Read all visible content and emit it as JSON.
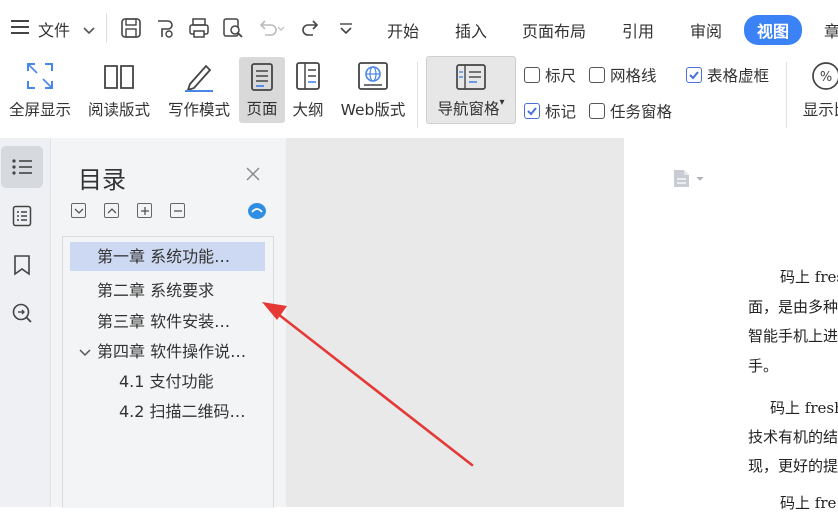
{
  "menubar": {
    "file_label": "文件",
    "tabs": [
      "开始",
      "插入",
      "页面布局",
      "引用",
      "审阅",
      "视图",
      "章"
    ],
    "active_tab": "视图"
  },
  "ribbon": {
    "buttons": {
      "fullscreen": "全屏显示",
      "reading": "阅读版式",
      "writing": "写作模式",
      "page": "页面",
      "outline": "大纲",
      "web": "Web版式",
      "nav_pane": "导航窗格",
      "display_ratio": "显示比"
    },
    "checkboxes": {
      "ruler": {
        "label": "标尺",
        "checked": false
      },
      "gridlines": {
        "label": "网格线",
        "checked": false
      },
      "table_gridlines": {
        "label": "表格虚框",
        "checked": true
      },
      "marks": {
        "label": "标记",
        "checked": true
      },
      "task_pane": {
        "label": "任务窗格",
        "checked": false
      }
    }
  },
  "toc": {
    "title": "目录",
    "items": [
      {
        "label": "第一章   系统功能…",
        "selected": true
      },
      {
        "label": "第二章   系统要求",
        "selected": false
      },
      {
        "label": "第三章   软件安装…",
        "selected": false
      },
      {
        "label": "第四章  软件操作说…",
        "selected": false
      },
      {
        "label": "4.1  支付功能",
        "selected": false
      },
      {
        "label": "4.2   扫描二维码…",
        "selected": false
      }
    ]
  },
  "document": {
    "lines": [
      "码上 fres",
      "面，是由多种",
      "智能手机上进",
      "手。",
      "码上 fresh",
      "技术有机的结",
      "现，更好的提",
      "码上 fre"
    ]
  },
  "colors": {
    "accent": "#3b82f6",
    "selection": "#cdd9f2",
    "arrow": "#e53935"
  }
}
